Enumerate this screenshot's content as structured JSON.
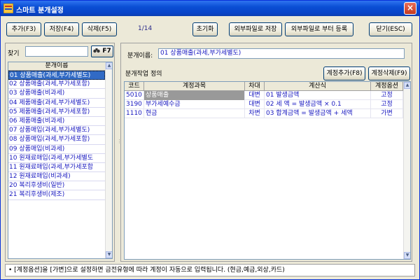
{
  "window": {
    "title": "스마트 분개설정",
    "close_icon": "close-icon",
    "app_icon": "app-icon"
  },
  "toolbar": {
    "add_label": "추가(F3)",
    "save_label": "저장(F4)",
    "delete_label": "삭제(F5)",
    "page_count": "1/14",
    "reset_label": "초기화",
    "export_label": "외부파일로 저장",
    "import_label": "외부파일로 부터 등록",
    "close_label": "닫기(ESC)"
  },
  "left_panel": {
    "find_label": "찾기",
    "find_value": "",
    "find_button_icon": "binoculars-icon",
    "find_button_label": "F7",
    "list_header": "분개이름",
    "items": [
      "01 상품매출(과세,부가세별도)",
      "02 상품매출(과세,부가세포함)",
      "03 상품매출(비과세)",
      "04 제품매출(과세,부가세별도)",
      "05 제품매출(과세,부가세포함)",
      "06 제품매출(비과세)",
      "07 상품매입(과세,부가세별도)",
      "08 상품매입(과세,부가세포함)",
      "09 상품매입(비과세)",
      "10 원재료매입(과세,부가세별도",
      "11 원재료매입(과세,부가세포함",
      "12 원재료매입(비과세)",
      "20 복리후생비(일반)",
      "21 복리후생비(제조)"
    ],
    "selected_index": 0
  },
  "right_panel": {
    "name_label": "분개이름:",
    "name_value": "01 상품매출(과세,부가세별도)",
    "def_label": "분개작업 정의",
    "add_account_label": "계정추가(F8)",
    "delete_account_label": "계정삭제(F9)",
    "columns": [
      "코드",
      "계정과목",
      "차대",
      "계산식",
      "계정옵션"
    ],
    "rows": [
      {
        "code": "5010",
        "account": "상품매출",
        "side": "대변",
        "formula": "01 발생금액",
        "option": "고정"
      },
      {
        "code": "3190",
        "account": "부가세예수금",
        "side": "대변",
        "formula": "02 세    액  = 발생금액 × 0.1",
        "option": "고정"
      },
      {
        "code": "1110",
        "account": "현금",
        "side": "차변",
        "formula": "03 합계금액 = 발생금액 + 세액",
        "option": "가변"
      }
    ]
  },
  "status": {
    "text": "• [계정옵션]을 [가변]으로 설정하면 금전유형에 따라 계정이 자동으로 입력됩니다. (현금,예금,외상,카드)"
  },
  "colors": {
    "titlebar": "#0a4fd4",
    "selection": "#316ac5",
    "list_text": "#1818c0",
    "selected_cell": "#999999"
  }
}
